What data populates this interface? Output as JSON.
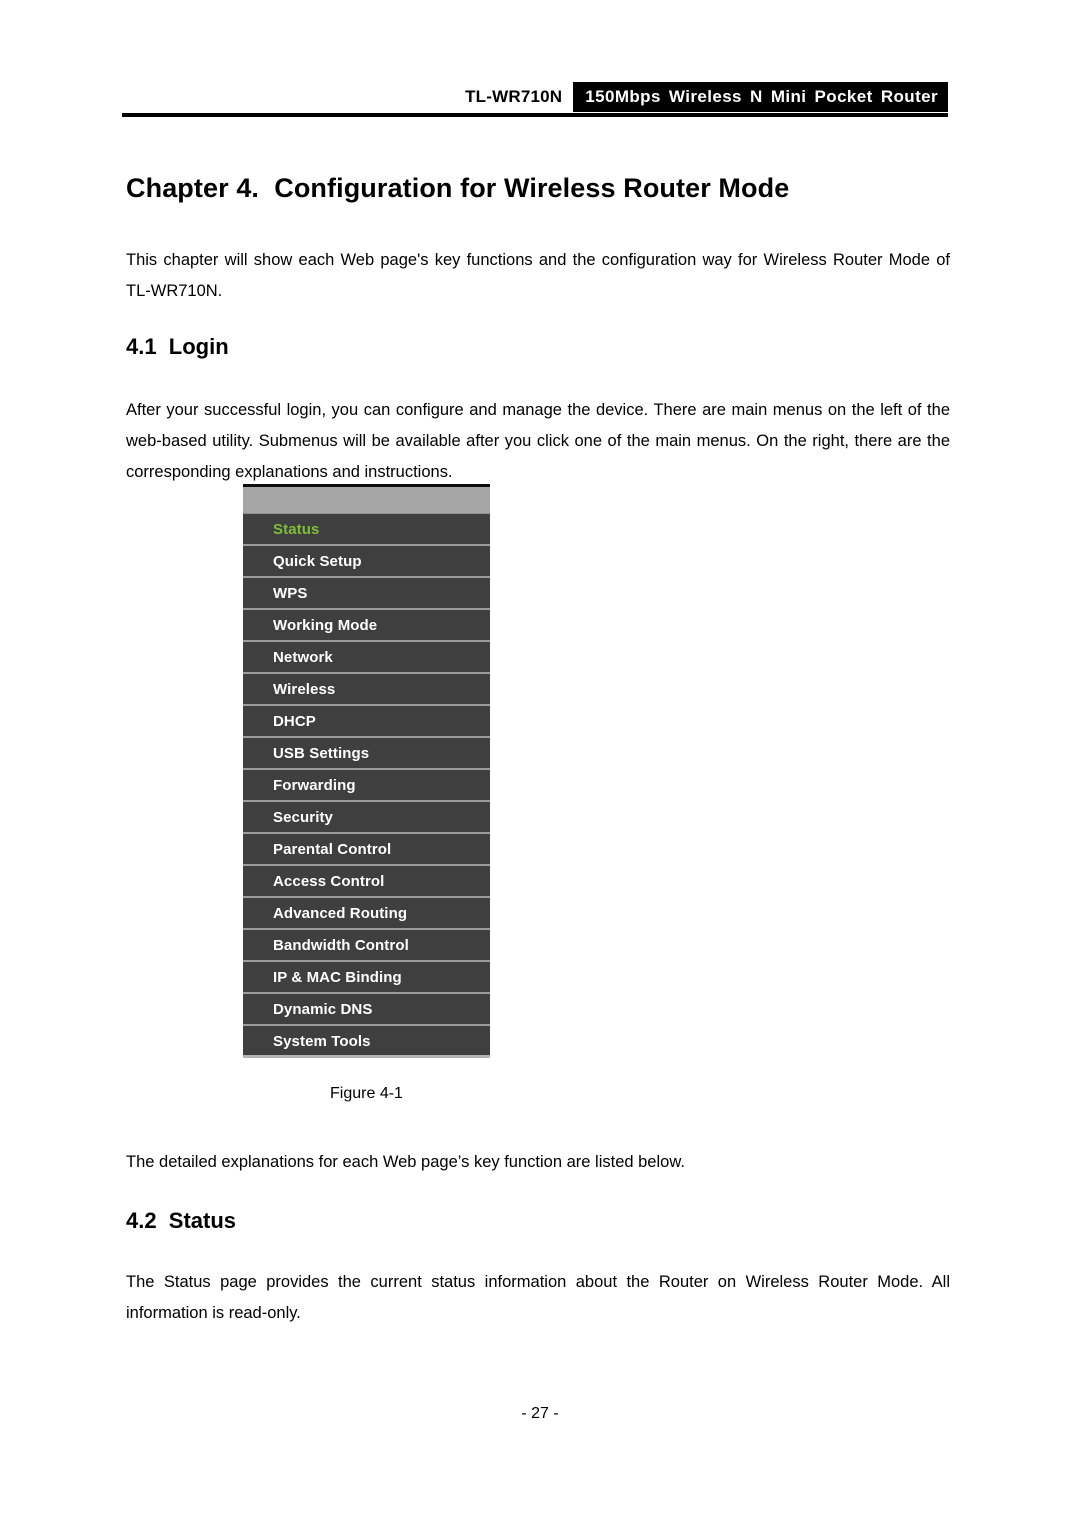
{
  "header": {
    "model": "TL-WR710N",
    "product_banner": "150Mbps Wireless N Mini Pocket Router",
    "banner_bg": "#000000",
    "banner_fg": "#ffffff"
  },
  "chapter": {
    "title": "Chapter 4.  Configuration for Wireless Router Mode",
    "intro": "This chapter will show each Web page's key functions and the configuration way for Wireless Router Mode of TL-WR710N."
  },
  "sections": [
    {
      "number": "4.1",
      "heading": "4.1  Login",
      "body": "After your successful login, you can configure and manage the device. There are main menus on the left of the web-based utility. Submenus will be available after you click one of the main menus. On the right, there are the corresponding explanations and instructions."
    },
    {
      "number": "4.2",
      "heading": "4.2  Status",
      "body": "The Status page provides the current status information about the Router on Wireless Router Mode. All information is read-only."
    }
  ],
  "figure": {
    "caption": "Figure 4-1",
    "after_text": "The detailed explanations for each Web page’s key function are listed below.",
    "menu": {
      "active_color": "#7fbf36",
      "item_bg": "#3f3f3f",
      "item_fg": "#ffffff",
      "topbar_bg": "#a6a6a6",
      "items": [
        {
          "label": "Status",
          "active": true
        },
        {
          "label": "Quick Setup",
          "active": false
        },
        {
          "label": "WPS",
          "active": false
        },
        {
          "label": "Working Mode",
          "active": false
        },
        {
          "label": "Network",
          "active": false
        },
        {
          "label": "Wireless",
          "active": false
        },
        {
          "label": "DHCP",
          "active": false
        },
        {
          "label": "USB Settings",
          "active": false
        },
        {
          "label": "Forwarding",
          "active": false
        },
        {
          "label": "Security",
          "active": false
        },
        {
          "label": "Parental Control",
          "active": false
        },
        {
          "label": "Access Control",
          "active": false
        },
        {
          "label": "Advanced Routing",
          "active": false
        },
        {
          "label": "Bandwidth Control",
          "active": false
        },
        {
          "label": "IP & MAC Binding",
          "active": false
        },
        {
          "label": "Dynamic DNS",
          "active": false
        },
        {
          "label": "System Tools",
          "active": false
        }
      ]
    }
  },
  "footer": {
    "page_number": "- 27 -"
  }
}
